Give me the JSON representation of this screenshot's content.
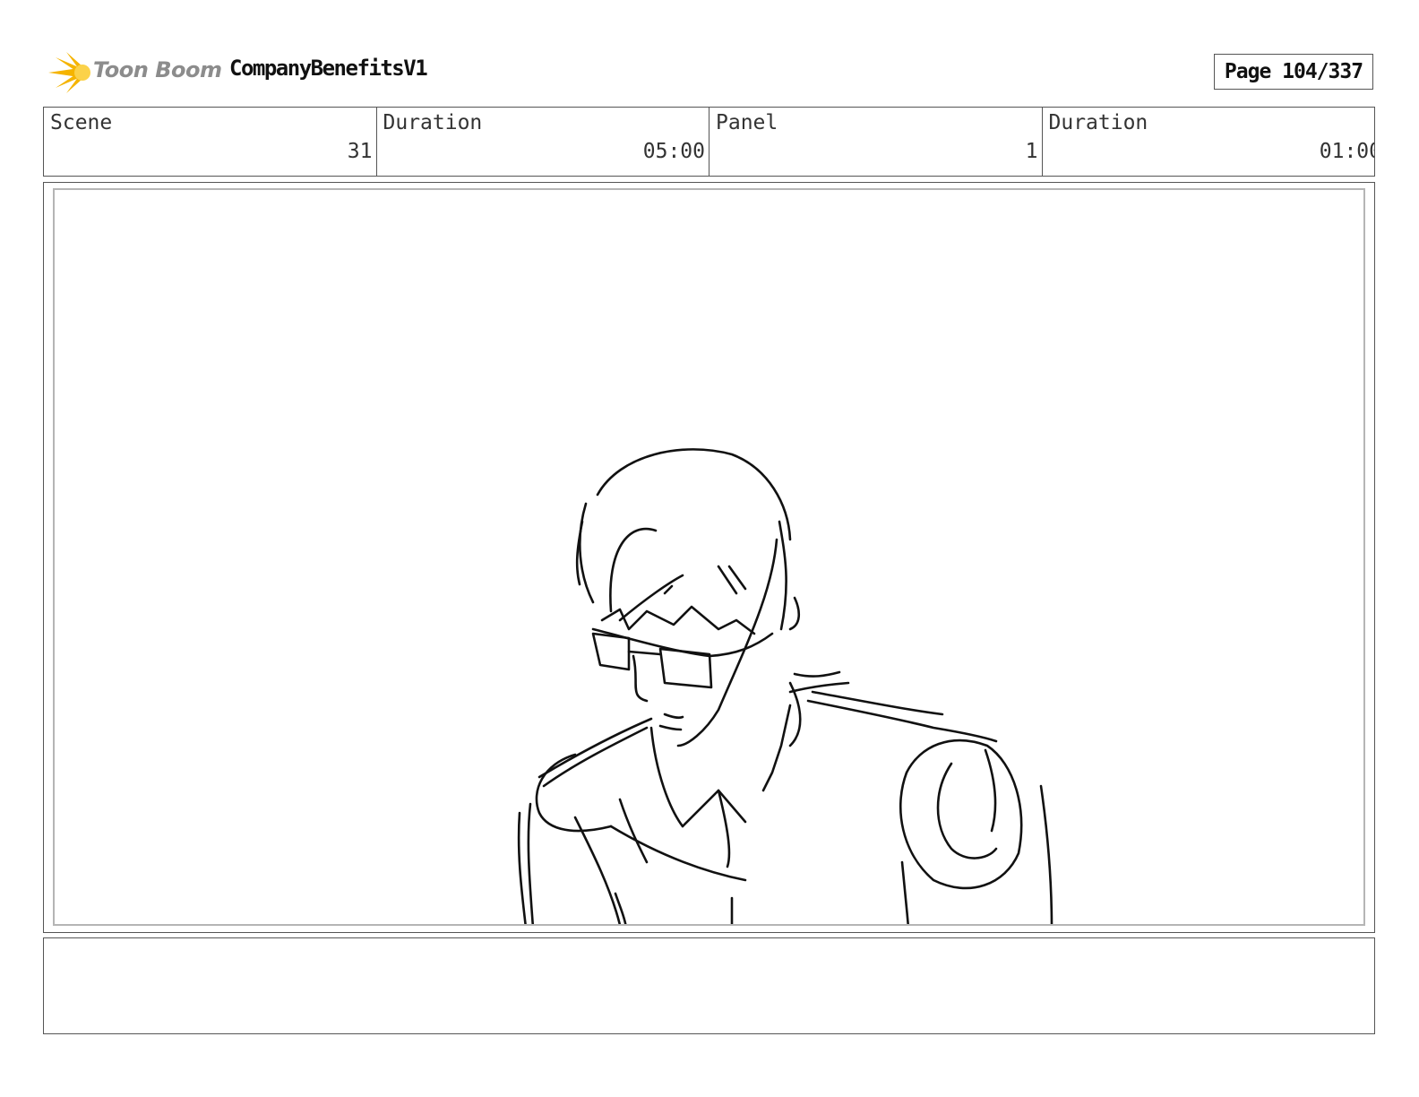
{
  "header": {
    "brand": "Toon Boom",
    "project_title": "CompanyBenefitsV1",
    "page_label": "Page 104/337"
  },
  "info": {
    "scene_label": "Scene",
    "scene_value": "31",
    "scene_duration_label": "Duration",
    "scene_duration_value": "05:00",
    "panel_label": "Panel",
    "panel_value": "1",
    "panel_duration_label": "Duration",
    "panel_duration_value": "01:00"
  },
  "notes": {
    "text": ""
  },
  "colors": {
    "logo_flare": "#f5b400",
    "logo_text": "#8c8c8c",
    "border": "#555555"
  }
}
